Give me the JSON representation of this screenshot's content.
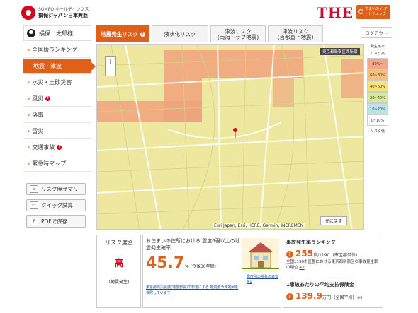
{
  "header": {
    "brand_sub": "SOMPO ホールディングス",
    "brand_name": "損保ジャパン日本興亜",
    "the_logo": "THE",
    "badge_text": "すまいの ハザードチェック"
  },
  "user": {
    "name": "損保　太郎様"
  },
  "sidebar": {
    "items": [
      {
        "label": "全国版ランキング",
        "warn": ""
      },
      {
        "label": "地震・津波",
        "warn": ""
      },
      {
        "label": "水災・土砂災害",
        "warn": ""
      },
      {
        "label": "風災",
        "warn": "!"
      },
      {
        "label": "落雷",
        "warn": ""
      },
      {
        "label": "雪災",
        "warn": ""
      },
      {
        "label": "交通事故",
        "warn": "!"
      },
      {
        "label": "緊急時マップ",
        "warn": ""
      }
    ],
    "buttons": [
      {
        "label": "リスク度サマリ",
        "icon": "≡"
      },
      {
        "label": "クイック試算",
        "icon": "▭"
      },
      {
        "label": "PDFで保存",
        "icon": "P"
      }
    ]
  },
  "tabs": [
    {
      "label": "地震発生リスク",
      "warn": "!"
    },
    {
      "label": "液状化リスク",
      "warn": ""
    },
    {
      "label": "津波リスク\n(南海トラフ地震)",
      "warn": ""
    },
    {
      "label": "津波リスク\n(首都直下地震)",
      "warn": ""
    }
  ],
  "logout": "ログアウト",
  "map": {
    "badge": "東京都新宿区西新宿",
    "attribution": "Esri Japan, Esri, HERE, Garmin, INCREMEN",
    "back_button": "元に戻す",
    "zoom_in": "+",
    "zoom_out": "−"
  },
  "legend": {
    "title": "発生確率",
    "header": "リスク高",
    "footer": "リスク低",
    "bands": [
      {
        "label": "80%~",
        "color": "#f5a58a"
      },
      {
        "label": "60~80%",
        "color": "#f7c07a"
      },
      {
        "label": "40~60%",
        "color": "#f5e17a"
      },
      {
        "label": "20~40%",
        "color": "#d6ea8f"
      },
      {
        "label": "10~20%",
        "color": "#b9e3e8"
      },
      {
        "label": "0~10%",
        "color": "#ffffff"
      }
    ]
  },
  "risk_level": {
    "title": "リスク度合",
    "value": "高",
    "sub": "(地震発生)"
  },
  "probability": {
    "desc": "お住まいの住所における 震度6弱以上の地震発生確率",
    "value": "45.7",
    "unit": "% (今後30年間)",
    "link": "東京都防災会議(地震部会)の想定による 地震動予測地図を参照しています"
  },
  "house": {
    "caption": "震度別の揺れの目安 ※1"
  },
  "ranking": {
    "title": "事故発生率ランキング",
    "value": "255",
    "value_unit": "位/1190",
    "scope": "(市区郡単位)",
    "desc": "全国1190市区郡における東京都新宿区の事故発生率の順位",
    "note": "※2"
  },
  "payout": {
    "title": "1事故あたりの平均支払保険金",
    "value": "139.9",
    "unit": "万円",
    "scope": "(全国平均)",
    "note": "※6"
  }
}
